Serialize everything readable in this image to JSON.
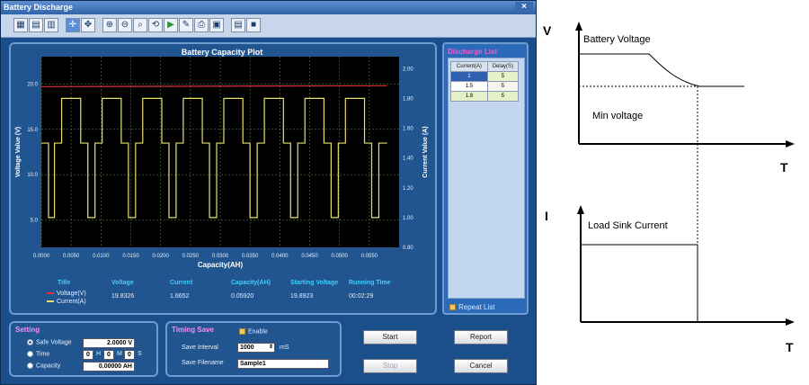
{
  "window": {
    "title": "Battery Discharge",
    "close": "×"
  },
  "plot": {
    "title": "Battery Capacity Plot",
    "xlabel": "Capacity(AH)",
    "ylabel_left": "Voltage Value (V)",
    "ylabel_right": "Current Value (A)",
    "x_ticks": [
      "0.0000",
      "0.0050",
      "0.0100",
      "0.0150",
      "0.0200",
      "0.0250",
      "0.0300",
      "0.0350",
      "0.0400",
      "0.0450",
      "0.0500",
      "0.0550"
    ],
    "y_left_ticks": [
      "5.0",
      "10.0",
      "15.0",
      "20.0"
    ],
    "y_right_ticks": [
      "0.80",
      "1.00",
      "1.20",
      "1.40",
      "1.60",
      "1.80",
      "2.00"
    ],
    "colors": {
      "voltage": "#e0303c",
      "current": "#e8e06a",
      "bg": "#000000",
      "grid": "#4a6a3a"
    }
  },
  "chart_data": {
    "type": "line",
    "title": "Battery Capacity Plot",
    "xlabel": "Capacity(AH)",
    "ylabel": "Voltage Value (V)",
    "y2label": "Current Value (A)",
    "xlim": [
      0,
      0.06
    ],
    "ylim": [
      2,
      23
    ],
    "y2lim": [
      0.8,
      2.08
    ],
    "series": [
      {
        "name": "Voltage(V)",
        "axis": "left",
        "x": [
          0,
          0.058
        ],
        "values": [
          19.7,
          19.8
        ]
      },
      {
        "name": "Current(A)",
        "axis": "right",
        "x": [
          0,
          0.0012,
          0.0012,
          0.0022,
          0.0022,
          0.0034,
          0.0034,
          0.0066,
          0.0066,
          0.0078,
          0.0078,
          0.009,
          0.009,
          0.0102,
          0.0102,
          0.0134,
          0.0134,
          0.0146,
          0.0146,
          0.0158,
          0.0158,
          0.017,
          0.017,
          0.0202,
          0.0202,
          0.0214,
          0.0214,
          0.0226,
          0.0226,
          0.0238,
          0.0238,
          0.027,
          0.027,
          0.0282,
          0.0282,
          0.0294,
          0.0294,
          0.0306,
          0.0306,
          0.0338,
          0.0338,
          0.035,
          0.035,
          0.0362,
          0.0362,
          0.0374,
          0.0374,
          0.0406,
          0.0406,
          0.0418,
          0.0418,
          0.043,
          0.043,
          0.0442,
          0.0442,
          0.0474,
          0.0474,
          0.0486,
          0.0486,
          0.0498,
          0.0498,
          0.051,
          0.051,
          0.0542,
          0.0542,
          0.0554,
          0.0554,
          0.0566,
          0.0566,
          0.058
        ],
        "values": [
          1.5,
          1.5,
          1.0,
          1.0,
          1.5,
          1.5,
          1.8,
          1.8,
          1.5,
          1.5,
          1.0,
          1.0,
          1.5,
          1.5,
          1.8,
          1.8,
          1.5,
          1.5,
          1.0,
          1.0,
          1.5,
          1.5,
          1.8,
          1.8,
          1.5,
          1.5,
          1.0,
          1.0,
          1.5,
          1.5,
          1.8,
          1.8,
          1.5,
          1.5,
          1.0,
          1.0,
          1.5,
          1.5,
          1.8,
          1.8,
          1.5,
          1.5,
          1.0,
          1.0,
          1.5,
          1.5,
          1.8,
          1.8,
          1.5,
          1.5,
          1.0,
          1.0,
          1.5,
          1.5,
          1.8,
          1.8,
          1.5,
          1.5,
          1.0,
          1.0,
          1.5,
          1.5,
          1.8,
          1.8,
          1.5,
          1.5,
          1.0,
          1.0,
          1.5,
          1.5
        ]
      }
    ],
    "grid": true
  },
  "legend": {
    "headers": [
      "Title",
      "Voltage",
      "Current",
      "Capacity(AH)",
      "Starting Voltage",
      "Running Time"
    ],
    "voltage_label": "Voltage(V)",
    "current_label": "Current(A)",
    "voltage": "19.8326",
    "current": "1.6652",
    "capacity": "0.05920",
    "starting_voltage": "19.8923",
    "running_time": "00:02:29"
  },
  "discharge_list": {
    "title": "Discharge List",
    "columns": [
      "Current(A)",
      "Delay(S)"
    ],
    "rows": [
      [
        "1",
        "5"
      ],
      [
        "1.5",
        "5"
      ],
      [
        "1.8",
        "5"
      ]
    ],
    "repeat_label": "Repeat List"
  },
  "setting": {
    "title": "Setting",
    "safe_voltage_label": "Safe Voltage",
    "safe_voltage_value": "2.0000 V",
    "time_label": "Time",
    "time_h": "0",
    "h": "H",
    "time_m": "0",
    "m": "M",
    "time_s": "0",
    "s": "S",
    "capacity_label": "Capacity",
    "capacity_value": "0.00000 AH"
  },
  "timing": {
    "title": "Timing Save",
    "enable_label": "Enable",
    "interval_label": "Save Interval",
    "interval_value": "1000",
    "interval_unit": "mS",
    "filename_label": "Save Filename",
    "filename_value": "Sample1"
  },
  "buttons": {
    "start": "Start",
    "stop": "Stop",
    "report": "Report",
    "cancel": "Cancel"
  },
  "diagram": {
    "v_axis": "V",
    "battery_voltage": "Battery Voltage",
    "min_voltage": "Min voltage",
    "t1": "T",
    "i_axis": "I",
    "load_sink": "Load Sink Current",
    "t2": "T"
  }
}
